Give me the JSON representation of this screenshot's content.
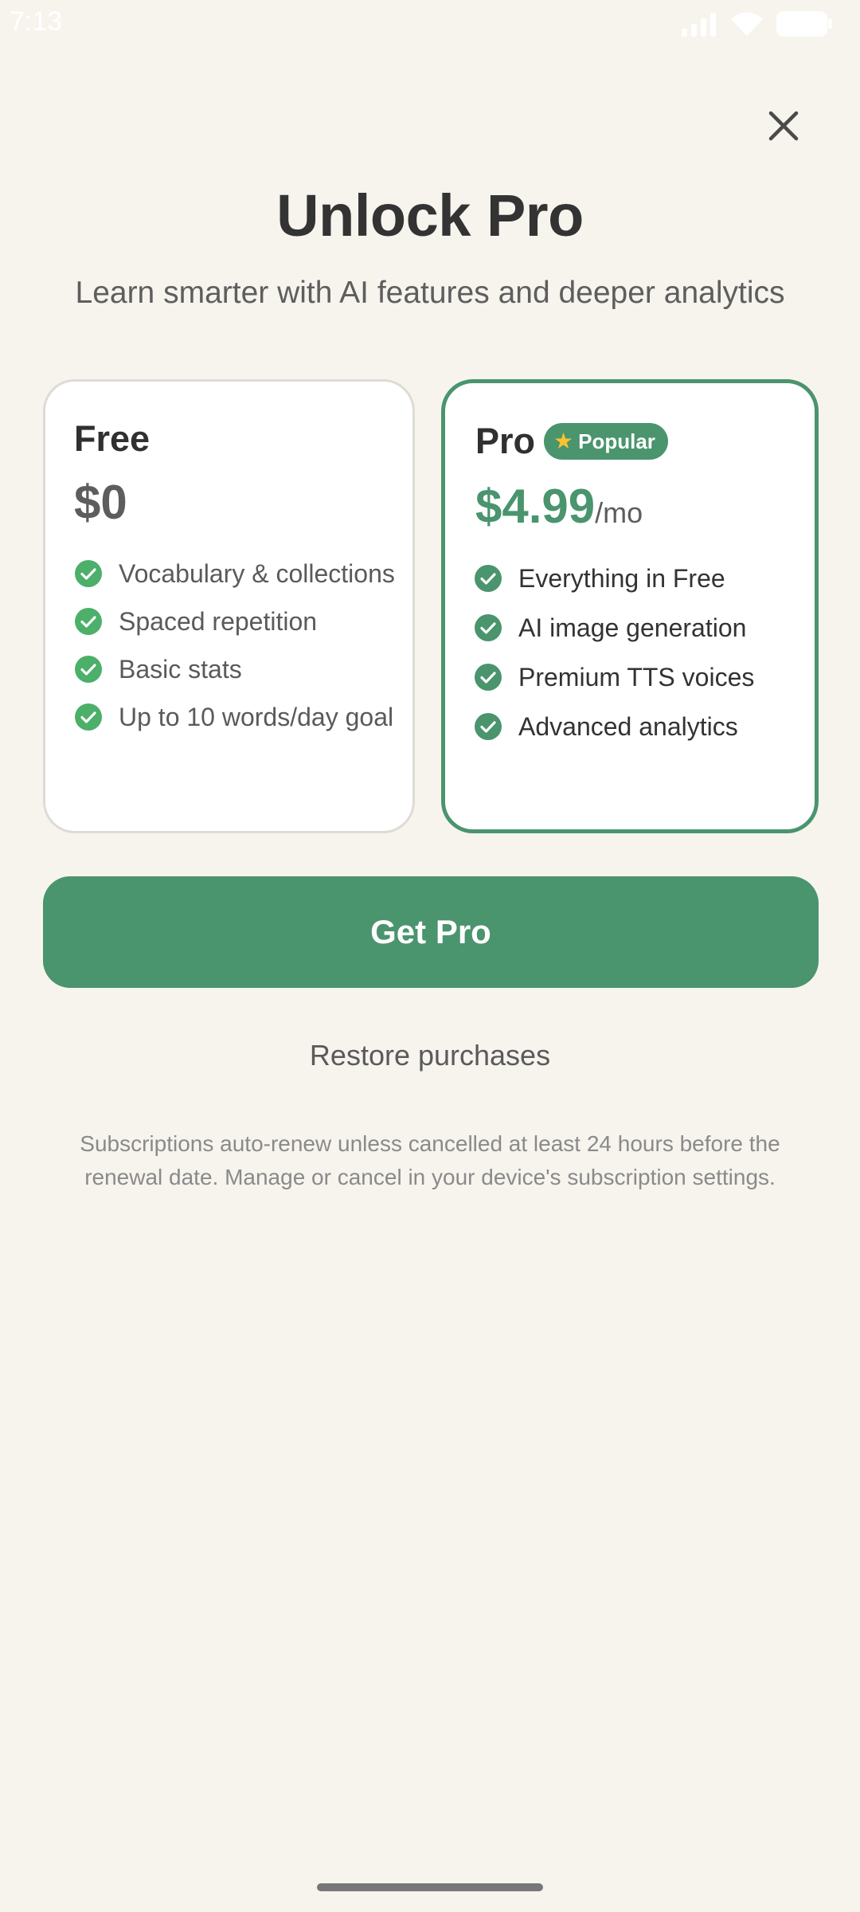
{
  "status_bar": {
    "time": "7:13",
    "icons": [
      "signal-icon",
      "wifi-icon",
      "battery-icon"
    ]
  },
  "header": {
    "close_icon": "close-icon",
    "title": "Unlock Pro",
    "subtitle": "Learn smarter with AI features and deeper analytics"
  },
  "plans": {
    "free": {
      "name": "Free",
      "price": "$0",
      "features": [
        "Vocabulary & collections",
        "Spaced repetition",
        "Basic stats",
        "Up to 10 words/day goal"
      ]
    },
    "pro": {
      "name": "Pro",
      "badge_icon": "star-icon",
      "badge": "Popular",
      "price": "$4.99",
      "period": "/mo",
      "features": [
        "Everything in Free",
        "AI image generation",
        "Premium TTS voices",
        "Advanced analytics"
      ],
      "selected": true
    }
  },
  "cta": {
    "label": "Get Pro"
  },
  "restore": {
    "label": "Restore purchases"
  },
  "legal": {
    "text": "Subscriptions auto-renew unless cancelled at least 24 hours before the renewal date. Manage or cancel in your device's subscription settings."
  },
  "colors": {
    "background": "#f7f4ee",
    "accent": "#4a946e",
    "check": "#4caf6a",
    "star": "#f6c431"
  }
}
